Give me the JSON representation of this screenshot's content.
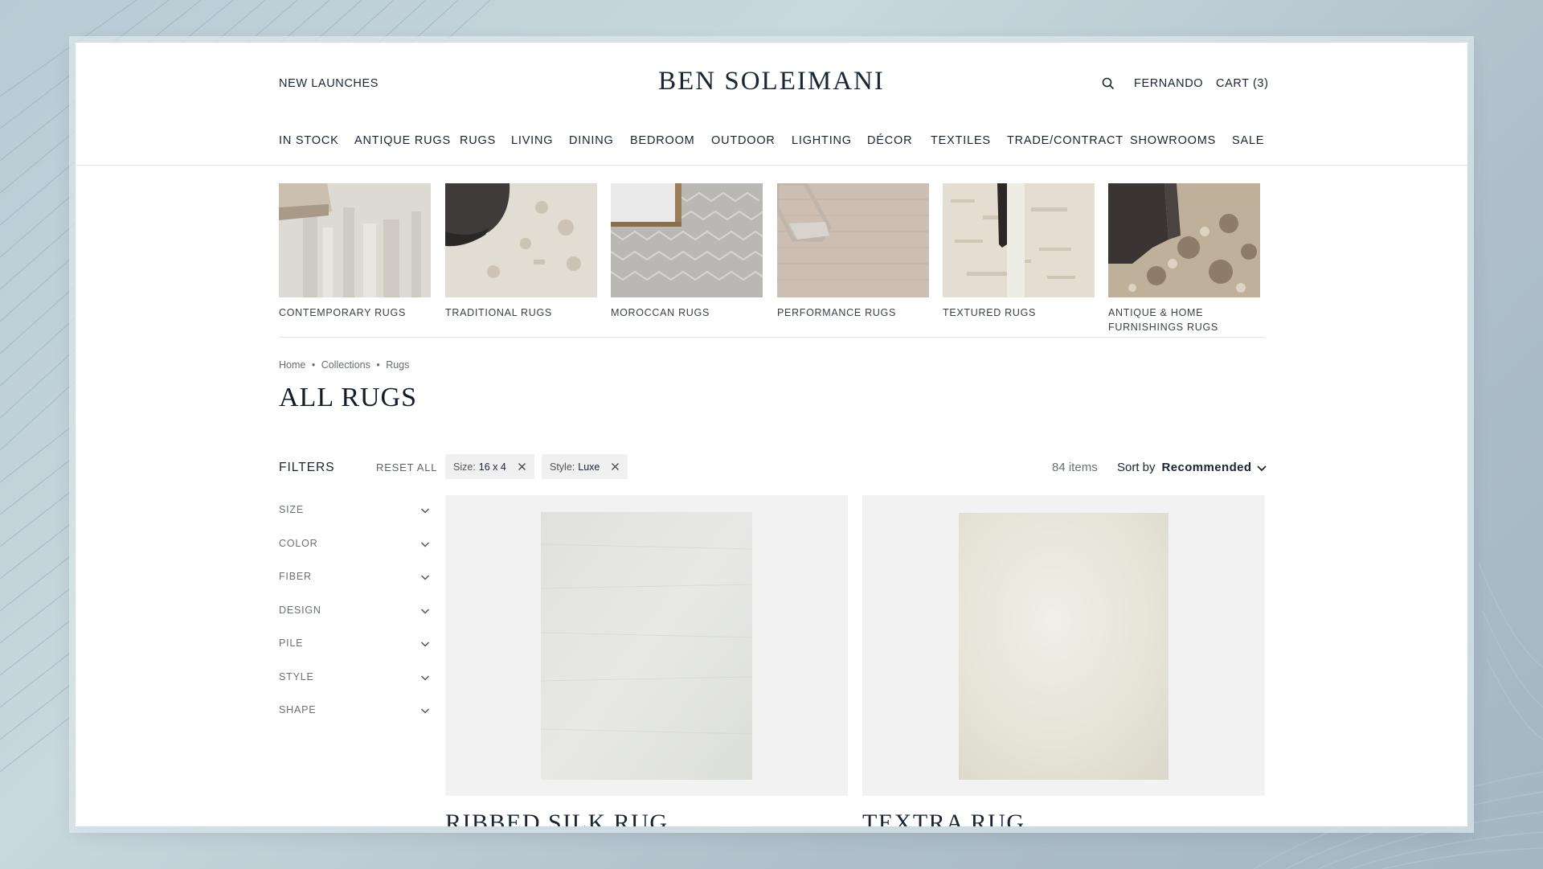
{
  "header": {
    "new_launches": "NEW LAUNCHES",
    "logo": "BEN SOLEIMANI",
    "user": "FERNANDO",
    "cart": "CART (3)"
  },
  "nav": [
    "IN STOCK",
    "ANTIQUE RUGS",
    "RUGS",
    "LIVING",
    "DINING",
    "BEDROOM",
    "OUTDOOR",
    "LIGHTING",
    "DÉCOR",
    "TEXTILES",
    "TRADE/CONTRACT",
    "SHOWROOMS",
    "SALE"
  ],
  "categories": [
    {
      "line1": "CONTEMPORARY RUGS",
      "line2": ""
    },
    {
      "line1": "TRADITIONAL RUGS",
      "line2": ""
    },
    {
      "line1": "MOROCCAN RUGS",
      "line2": ""
    },
    {
      "line1": "PERFORMANCE RUGS",
      "line2": ""
    },
    {
      "line1": "TEXTURED RUGS",
      "line2": ""
    },
    {
      "line1": "ANTIQUE & HOME",
      "line2": "FURNISHINGS RUGS"
    }
  ],
  "breadcrumb": [
    "Home",
    "Collections",
    "Rugs"
  ],
  "breadcrumb_sep": "•",
  "page_title": "ALL RUGS",
  "filters": {
    "title": "FILTERS",
    "reset": "RESET ALL",
    "facets": [
      "SIZE",
      "COLOR",
      "FIBER",
      "DESIGN",
      "PILE",
      "STYLE",
      "SHAPE"
    ]
  },
  "active_filters": [
    {
      "label": "Size:",
      "value": "16 x 4"
    },
    {
      "label": "Style:",
      "value": "Luxe"
    }
  ],
  "results": {
    "count": "84 items",
    "sort_label": "Sort by",
    "sort_value": "Recommended"
  },
  "products": [
    {
      "name": "RIBBED SILK RUG"
    },
    {
      "name": "TEXTRA RUG"
    }
  ],
  "colors": {
    "ink": "#1a2433",
    "muted": "#6a7076",
    "card_bg": "#f2f2f2",
    "chip_bg": "#f0f0f0"
  }
}
